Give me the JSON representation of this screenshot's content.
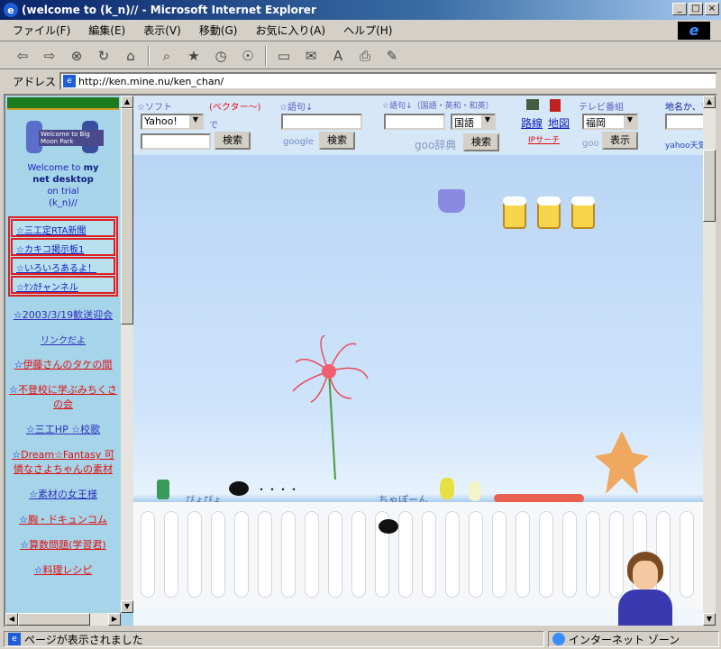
{
  "window": {
    "title": "(welcome to (k_n)// - Microsoft Internet Explorer",
    "min": "_",
    "max": "□",
    "close": "×"
  },
  "menu": [
    "ファイル(F)",
    "編集(E)",
    "表示(V)",
    "移動(G)",
    "お気に入り(A)",
    "ヘルプ(H)"
  ],
  "address": {
    "label": "アドレス",
    "url": "http://ken.mine.nu/ken_chan/"
  },
  "left": {
    "welcome": [
      "Welcome to",
      "my",
      "net desktop",
      "on trial",
      "(k_n)//"
    ],
    "mascot_text": "Welcome to Big Moon Park",
    "nav": [
      "三工定RTA新聞",
      "カキコ掲示板1",
      "いろいろあるよ！",
      "ｹﾝｶﾁャンネル"
    ],
    "links": [
      {
        "text": "2003/3/19歓送迎会",
        "color": "blue"
      },
      {
        "text": "リンクだよ",
        "color": "blue"
      },
      {
        "text": "伊藤さんのタケの間",
        "color": "red"
      },
      {
        "text": "不登校に学ぶみちくさの会",
        "color": "red"
      },
      {
        "text": "三工HP",
        "color": "blue",
        "extra": "☆校歌"
      },
      {
        "text": "Dream☆Fantasy 可憐なさよちゃんの素材",
        "color": "red"
      },
      {
        "text": "素材の女王様",
        "color": "blue"
      },
      {
        "text": "胸・ドキュンコム",
        "color": "red"
      },
      {
        "text": "算数問題(学習君)",
        "color": "red"
      },
      {
        "text": "料理レシピ",
        "color": "red"
      }
    ]
  },
  "tools": {
    "soft": {
      "head": "☆ソフト",
      "link": "(ベクター～)",
      "select": "Yahoo!",
      "de": "で",
      "button": "検索"
    },
    "google": {
      "head": "☆語句↓",
      "brand": "google",
      "button": "検索"
    },
    "goo": {
      "head": "☆語句↓（国語・英和・和英）",
      "select": "国語",
      "brand": "goo辞典",
      "button": "検索"
    },
    "route": {
      "line": "路線",
      "map": "地図",
      "ip": "IPサーチ"
    },
    "tv": {
      "head": "テレビ番組",
      "select": "福岡",
      "brand": "goo",
      "button": "表示"
    },
    "weather": {
      "head": "地名か、〒↓",
      "brand": "yahoo天気"
    }
  },
  "scene": {
    "pyoro": "ぴょぴょ",
    "dots": "・・・・",
    "chapon": "ちゃぽーん"
  },
  "status": {
    "text": "ページが表示されました",
    "zone": "インターネット ゾーン"
  }
}
